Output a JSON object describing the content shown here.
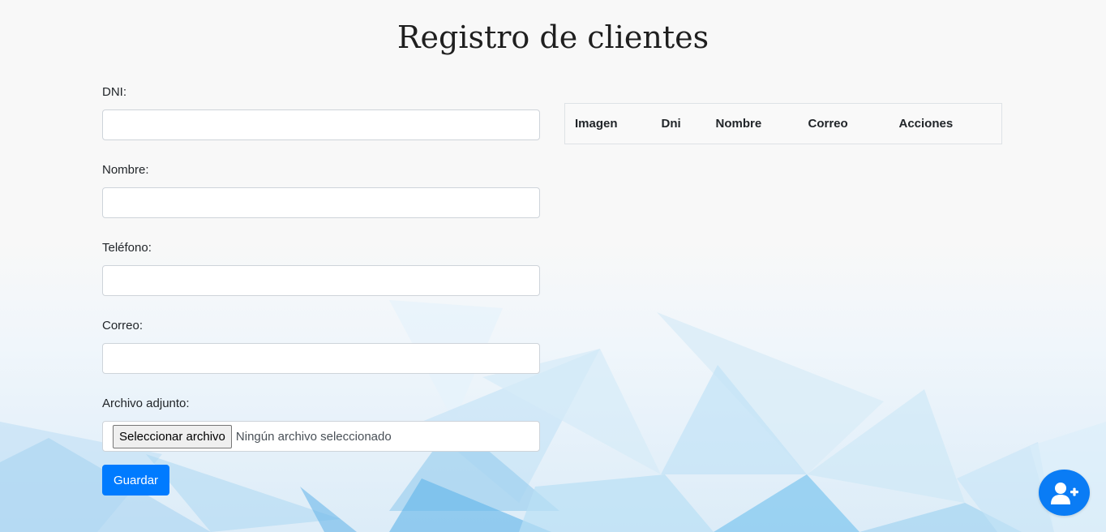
{
  "page": {
    "title": "Registro de clientes"
  },
  "form": {
    "dni_label": "DNI:",
    "dni_value": "",
    "nombre_label": "Nombre:",
    "nombre_value": "",
    "telefono_label": "Teléfono:",
    "telefono_value": "",
    "correo_label": "Correo:",
    "correo_value": "",
    "archivo_label": "Archivo adjunto:",
    "file_button_label": "Seleccionar archivo",
    "file_status": "Ningún archivo seleccionado",
    "save_label": "Guardar"
  },
  "table": {
    "columns": [
      "Imagen",
      "Dni",
      "Nombre",
      "Correo",
      "Acciones"
    ],
    "rows": []
  },
  "fab": {
    "icon": "user-plus-icon"
  },
  "colors": {
    "primary": "#007bff",
    "background": "#f8f8f8"
  }
}
